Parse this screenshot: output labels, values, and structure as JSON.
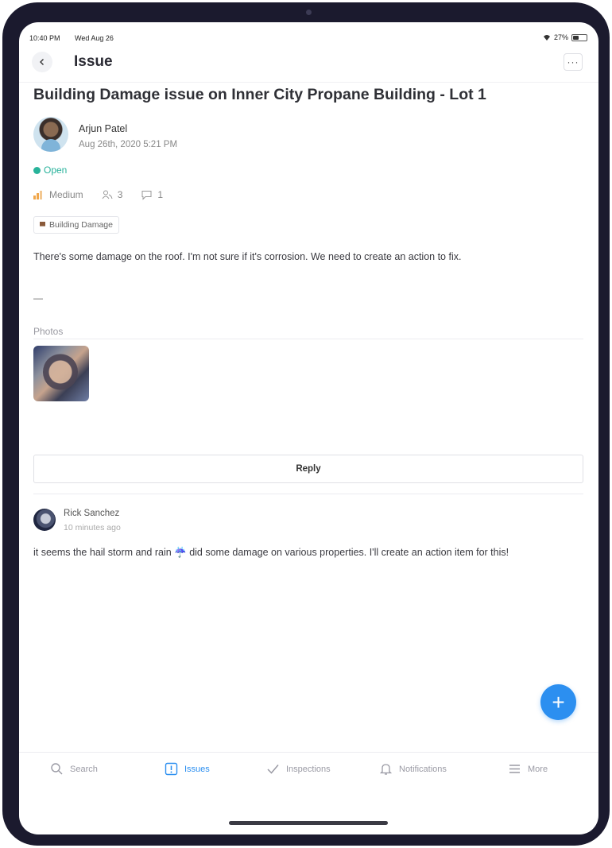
{
  "status_bar": {
    "time": "10:40 PM",
    "date": "Wed Aug 26",
    "battery": "27%"
  },
  "nav": {
    "title": "Issue",
    "more_label": "···"
  },
  "issue": {
    "title": "Building Damage issue on Inner City Propane Building - Lot 1",
    "author": "Arjun Patel",
    "date": "Aug 26th, 2020 5:21 PM",
    "status": "Open",
    "priority": "Medium",
    "assignees_count": "3",
    "comments_count": "1",
    "tag": "Building Damage",
    "description": "There's some damage on the roof. I'm not sure if it's corrosion. We need to create an action to fix.",
    "separator": "—",
    "photos_label": "Photos"
  },
  "reply": {
    "label": "Reply"
  },
  "comment": {
    "author": "Rick Sanchez",
    "time": "10 minutes ago",
    "text": "it seems the hail storm and rain ☔ did some damage on various properties. I'll create an action item for this!"
  },
  "fab": {
    "label": "+"
  },
  "tabs": [
    {
      "label": "Search",
      "icon": "search-icon",
      "active": false
    },
    {
      "label": "Issues",
      "icon": "issues-icon",
      "active": true
    },
    {
      "label": "Inspections",
      "icon": "checkmark-icon",
      "active": false
    },
    {
      "label": "Notifications",
      "icon": "bell-icon",
      "active": false
    },
    {
      "label": "More",
      "icon": "menu-icon",
      "active": false
    }
  ],
  "colors": {
    "accent": "#2c8ff0",
    "status_open": "#28b39a",
    "priority_medium": "#f0a64a",
    "device_frame": "#1b1a2e"
  }
}
